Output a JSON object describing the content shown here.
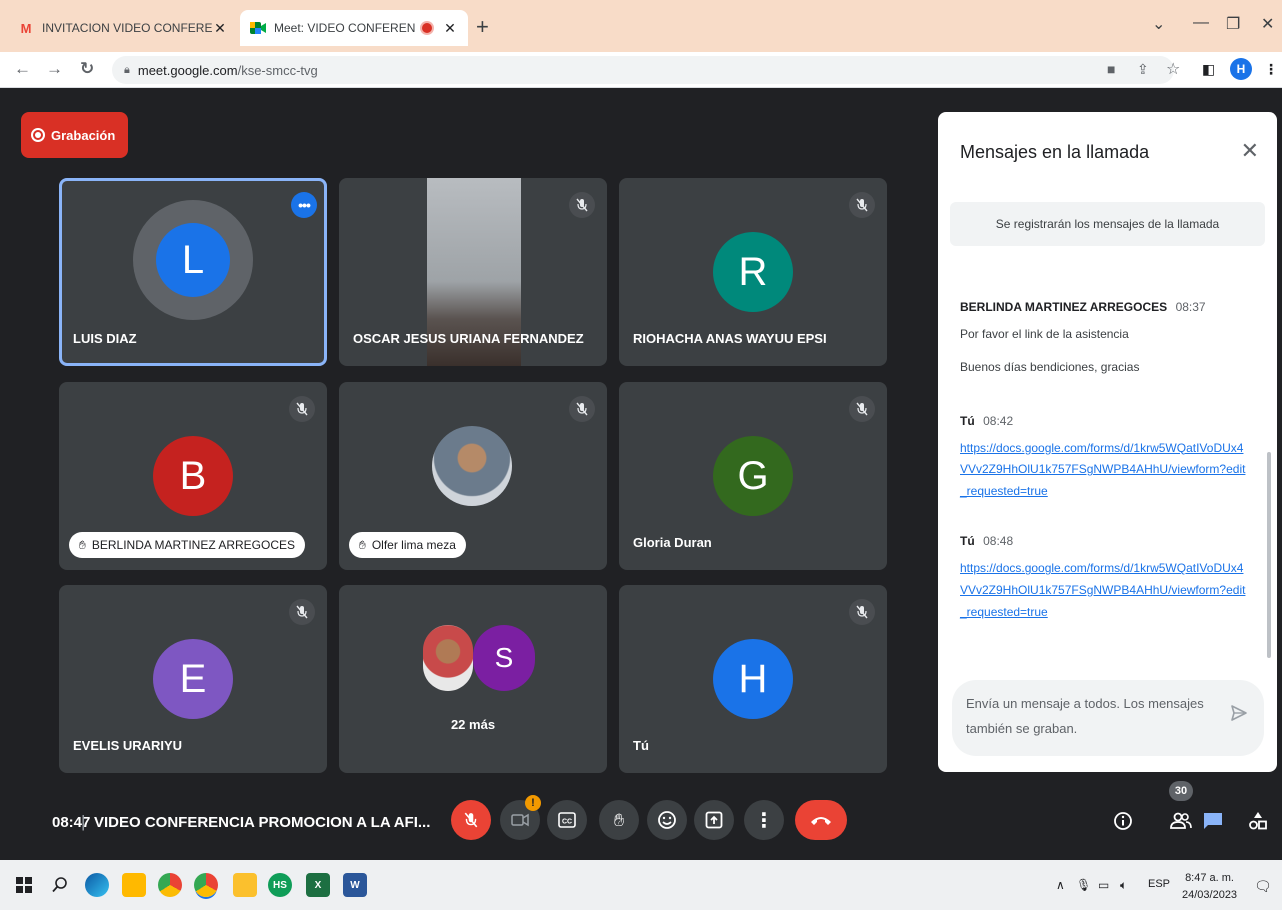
{
  "browser": {
    "tabs": [
      {
        "title": "INVITACION VIDEO CONFERENC",
        "favicon": "gmail-icon",
        "active": false
      },
      {
        "title": "Meet: VIDEO CONFERENCIA",
        "favicon": "meet-icon",
        "active": true
      }
    ],
    "new_tab_label": "+",
    "url_domain": "meet.google.com",
    "url_path": "/kse-smcc-tvg",
    "profile_initial": "H"
  },
  "recording": {
    "label": "Grabación"
  },
  "tiles": [
    {
      "name": "LUIS DIAZ",
      "initial": "L",
      "color": "#1a73e8"
    },
    {
      "name": "OSCAR JESUS URIANA FERNANDEZ"
    },
    {
      "name": "RIOHACHA ANAS WAYUU EPSI",
      "initial": "R",
      "color": "#00897b"
    },
    {
      "name": "BERLINDA MARTINEZ ARREGOCES",
      "initial": "B",
      "color": "#c5221f"
    },
    {
      "name": "Olfer lima meza"
    },
    {
      "name": "Gloria Duran",
      "initial": "G",
      "color": "#33691e"
    },
    {
      "name": "EVELIS URARIYU",
      "initial": "E",
      "color": "#7e57c2"
    },
    {
      "name": "22 más",
      "initial": "S",
      "color": "#7b1fa2"
    },
    {
      "name": "Tú",
      "initial": "H",
      "color": "#1a73e8"
    }
  ],
  "chat": {
    "title": "Mensajes en la llamada",
    "notice": "Se registrarán los mensajes de la llamada",
    "messages": [
      {
        "sender": "BERLINDA MARTINEZ ARREGOCES",
        "time": "08:37",
        "lines": [
          "Por favor el link de la asistencia",
          "Buenos días bendiciones, gracias"
        ]
      },
      {
        "sender": "Tú",
        "time": "08:42",
        "link": "https://docs.google.com/forms/d/1krw5WQatIVoDUx4VVv2Z9HhOlU1k757FSgNWPB4AHhU/viewform?edit_requested=true"
      },
      {
        "sender": "Tú",
        "time": "08:48",
        "link": "https://docs.google.com/forms/d/1krw5WQatIVoDUx4VVv2Z9HhOlU1k757FSgNWPB4AHhU/viewform?edit_requested=true"
      }
    ],
    "input_placeholder": "Envía un mensaje a todos. Los mensajes también se graban."
  },
  "bottom": {
    "time": "08:47",
    "meeting_title": "VIDEO CONFERENCIA PROMOCION A LA AFI...",
    "camera_warning": "!",
    "participant_count": "30"
  },
  "taskbar": {
    "language": "ESP",
    "time": "8:47 a. m.",
    "date": "24/03/2023"
  },
  "colors": {
    "meet_bg": "#202124",
    "tile_bg": "#3c4043",
    "accent_red": "#ea4335",
    "accent_blue": "#1a73e8",
    "tab_strip": "#f8dcc8"
  }
}
